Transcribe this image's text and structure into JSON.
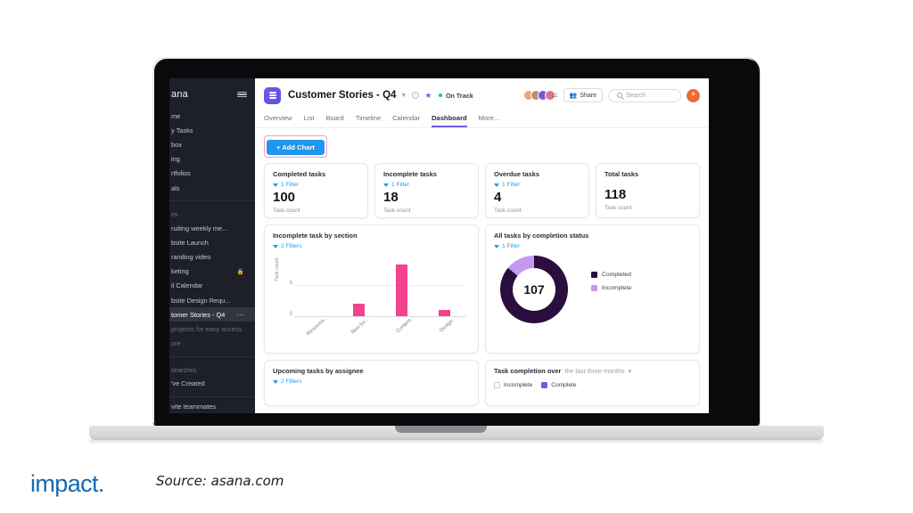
{
  "footer": {
    "logo": "impact.",
    "source": "Source: asana.com"
  },
  "sidebar": {
    "logo": "ana",
    "menu_icon": "hamburger-icon",
    "nav": [
      {
        "label": "me"
      },
      {
        "label": "y Tasks"
      },
      {
        "label": "box"
      },
      {
        "label": "ing"
      },
      {
        "label": "rtfolios"
      },
      {
        "label": "als"
      }
    ],
    "projects_header": "es",
    "projects": [
      {
        "label": "ruiting weekly me...",
        "locked": false,
        "active": false
      },
      {
        "label": "bsite Launch",
        "locked": false,
        "active": false
      },
      {
        "label": "randing video",
        "locked": false,
        "active": false
      },
      {
        "label": "keting",
        "locked": true,
        "active": false
      },
      {
        "label": "il Calendar",
        "locked": false,
        "active": false
      },
      {
        "label": "bsite Design Requ...",
        "locked": false,
        "active": false
      },
      {
        "label": "tomer Stories - Q4",
        "locked": false,
        "active": true
      }
    ],
    "projects_hint": "projects for easy access",
    "show_more": "ore",
    "searches_header": "searches",
    "searches": [
      {
        "label": "'ve Created"
      }
    ],
    "invite": "vite teammates"
  },
  "header": {
    "project_icon": "list-icon",
    "title": "Customer Stories - Q4",
    "chevron": "chevron-down-icon",
    "info_icon": "info-icon",
    "star_icon": "star-icon",
    "status": "On Track",
    "status_color": "#25c07e",
    "avatar_count": "11",
    "avatar_colors": [
      "#e8a87c",
      "#c98a6b",
      "#6d5bd0",
      "#e2718f"
    ],
    "share_label": "Share",
    "share_icon": "people-icon",
    "search_placeholder": "Search",
    "search_icon": "search-icon",
    "add_icon": "plus-icon",
    "add_color": "#f06a35"
  },
  "tabs": [
    {
      "label": "Overview",
      "active": false
    },
    {
      "label": "List",
      "active": false
    },
    {
      "label": "Board",
      "active": false
    },
    {
      "label": "Timeline",
      "active": false
    },
    {
      "label": "Calendar",
      "active": false
    },
    {
      "label": "Dashboard",
      "active": true
    },
    {
      "label": "More...",
      "active": false
    }
  ],
  "toolbar": {
    "add_chart_label": "+ Add Chart",
    "add_chart_color": "#2095f2"
  },
  "metrics": [
    {
      "title": "Completed tasks",
      "filter": "1 Filter",
      "value": "100",
      "subtitle": "Task count"
    },
    {
      "title": "Incomplete tasks",
      "filter": "1 Filter",
      "value": "18",
      "subtitle": "Task count"
    },
    {
      "title": "Overdue tasks",
      "filter": "1 Filter",
      "value": "4",
      "subtitle": "Task count"
    },
    {
      "title": "Total tasks",
      "filter": "",
      "value": "118",
      "subtitle": "Task count"
    }
  ],
  "bar_card": {
    "title": "Incomplete task by section",
    "filter": "2 Filters"
  },
  "donut_card": {
    "title": "All tasks by completion status",
    "filter": "1 Filter"
  },
  "assignee_card": {
    "title": "Upcoming tasks by assignee",
    "filter": "2 Filters"
  },
  "completion_card": {
    "title_strong": "Task completion over",
    "title_range": "the last three months",
    "chevron": "chevron-down-icon",
    "checkbox_incomplete": "Incomplete",
    "checkbox_complete": "Complete",
    "complete_color": "#6c5ce7"
  },
  "chart_data": [
    {
      "type": "bar",
      "title": "Incomplete task by section",
      "xlabel": "",
      "ylabel": "Task count",
      "categories": [
        "Resource...",
        "New for...",
        "Content",
        "Design"
      ],
      "values": [
        0,
        2,
        8,
        1
      ],
      "ylim": [
        0,
        10
      ],
      "yticks": [
        0,
        5
      ],
      "bar_color": "#f5428f",
      "grid": true,
      "legend": "none"
    },
    {
      "type": "pie",
      "title": "All tasks by completion status",
      "center_value": "107",
      "labels": [
        "Completed",
        "Incomplete"
      ],
      "values": [
        92,
        15
      ],
      "colors": [
        "#2a0e3d",
        "#c49bec"
      ],
      "legend": "right",
      "donut": true
    }
  ]
}
